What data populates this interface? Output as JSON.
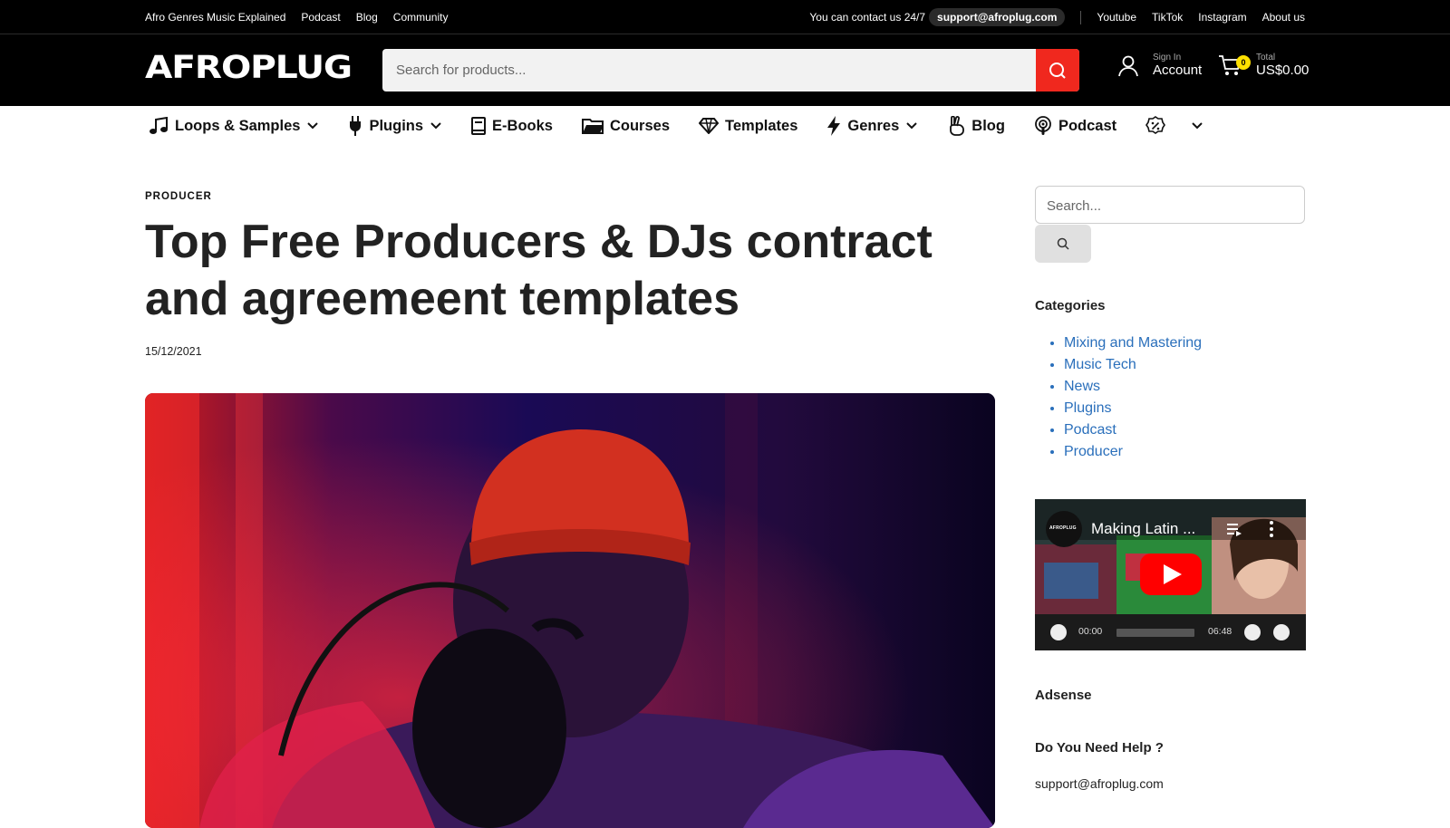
{
  "topbar": {
    "links": [
      "Afro Genres Music Explained",
      "Podcast",
      "Blog",
      "Community"
    ],
    "contact_text": "You can contact us 24/7",
    "contact_email": "support@afroplug.com",
    "social": [
      "Youtube",
      "TikTok",
      "Instagram",
      "About us"
    ]
  },
  "header": {
    "logo": "AFROPLUG",
    "search_placeholder": "Search for products...",
    "account_small": "Sign In",
    "account_big": "Account",
    "cart_count": "0",
    "cart_small": "Total",
    "cart_big": "US$0.00"
  },
  "nav": {
    "items": [
      {
        "label": "Loops & Samples",
        "icon": "music-note-icon",
        "dropdown": true
      },
      {
        "label": "Plugins",
        "icon": "plug-icon",
        "dropdown": true
      },
      {
        "label": "E-Books",
        "icon": "book-icon",
        "dropdown": false
      },
      {
        "label": "Courses",
        "icon": "folder-icon",
        "dropdown": false
      },
      {
        "label": "Templates",
        "icon": "diamond-icon",
        "dropdown": false
      },
      {
        "label": "Genres",
        "icon": "lightning-icon",
        "dropdown": true
      },
      {
        "label": "Blog",
        "icon": "peace-hand-icon",
        "dropdown": false
      },
      {
        "label": "Podcast",
        "icon": "podcast-icon",
        "dropdown": false
      }
    ],
    "more_icon": "discount-badge-icon"
  },
  "article": {
    "category": "PRODUCER",
    "title": "Top Free Producers & DJs contract and agreemeent templates",
    "date": "15/12/2021"
  },
  "sidebar": {
    "search_placeholder": "Search...",
    "categories_title": "Categories",
    "categories": [
      "Mixing and Mastering",
      "Music Tech",
      "News",
      "Plugins",
      "Podcast",
      "Producer"
    ],
    "video": {
      "channel": "AFROPLUG",
      "title": "Making Latin ...",
      "time_current": "00:00",
      "time_total": "06:48"
    },
    "adsense_title": "Adsense",
    "help_title": "Do You Need Help ?",
    "help_email": "support@afroplug.com"
  },
  "colors": {
    "accent": "#f0281e",
    "link": "#2a6fbb",
    "badge": "#ffe100"
  }
}
